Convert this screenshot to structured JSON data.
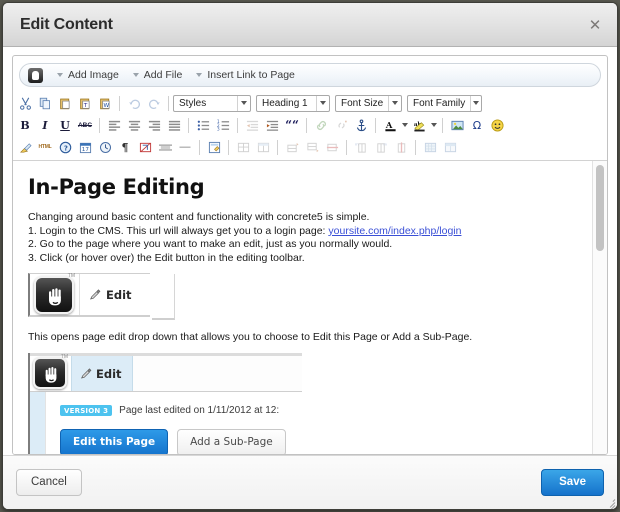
{
  "window": {
    "title": "Edit Content",
    "close_icon": "close-icon"
  },
  "c5bar": {
    "logo_icon": "concrete5-logo-icon",
    "items": [
      {
        "label": "Add Image",
        "icon": "caret-down-icon"
      },
      {
        "label": "Add File",
        "icon": "caret-down-icon"
      },
      {
        "label": "Insert Link to Page",
        "icon": "caret-down-icon"
      }
    ]
  },
  "toolbar": {
    "row1": [
      {
        "name": "cut-icon",
        "glyph": "✂"
      },
      {
        "name": "copy-icon",
        "glyph": ""
      },
      {
        "name": "paste-icon",
        "glyph": ""
      },
      {
        "name": "paste-as-plain-text-icon",
        "glyph": ""
      },
      {
        "name": "paste-from-word-icon",
        "glyph": ""
      },
      {
        "name": "undo-icon",
        "glyph": "↶"
      },
      {
        "name": "redo-icon",
        "glyph": "↷"
      }
    ],
    "selects": [
      {
        "name": "styles-select",
        "value": "Styles"
      },
      {
        "name": "format-select",
        "value": "Heading 1"
      },
      {
        "name": "font-size-select",
        "value": "Font Size"
      },
      {
        "name": "font-family-select",
        "value": "Font Family"
      }
    ],
    "row2": [
      {
        "name": "bold-icon",
        "glyph": "B"
      },
      {
        "name": "italic-icon",
        "glyph": "I"
      },
      {
        "name": "underline-icon",
        "glyph": "U"
      },
      {
        "name": "strikethrough-icon",
        "glyph": "ABC"
      },
      {
        "name": "align-left-icon",
        "glyph": ""
      },
      {
        "name": "align-center-icon",
        "glyph": ""
      },
      {
        "name": "align-right-icon",
        "glyph": ""
      },
      {
        "name": "align-justify-icon",
        "glyph": ""
      },
      {
        "name": "bulleted-list-icon",
        "glyph": ""
      },
      {
        "name": "numbered-list-icon",
        "glyph": ""
      },
      {
        "name": "decrease-indent-icon",
        "glyph": ""
      },
      {
        "name": "increase-indent-icon",
        "glyph": ""
      },
      {
        "name": "blockquote-icon",
        "glyph": "““"
      },
      {
        "name": "link-icon",
        "glyph": ""
      },
      {
        "name": "unlink-icon",
        "glyph": ""
      },
      {
        "name": "anchor-icon",
        "glyph": "⚓"
      },
      {
        "name": "text-color-icon",
        "glyph": "A"
      },
      {
        "name": "text-color-dropdown-icon",
        "glyph": ""
      },
      {
        "name": "background-color-icon",
        "glyph": "ab"
      },
      {
        "name": "background-color-dropdown-icon",
        "glyph": ""
      },
      {
        "name": "image-icon",
        "glyph": ""
      },
      {
        "name": "special-character-icon",
        "glyph": "Ω"
      },
      {
        "name": "smiley-icon",
        "glyph": "☺"
      }
    ],
    "row3": [
      {
        "name": "remove-format-icon",
        "glyph": ""
      },
      {
        "name": "source-html-icon",
        "glyph": "HTML"
      },
      {
        "name": "about-icon",
        "glyph": "?"
      },
      {
        "name": "insert-date-icon",
        "glyph": ""
      },
      {
        "name": "insert-time-icon",
        "glyph": ""
      },
      {
        "name": "show-blocks-icon",
        "glyph": "¶"
      },
      {
        "name": "insert-flash-icon",
        "glyph": ""
      },
      {
        "name": "page-break-icon",
        "glyph": ""
      },
      {
        "name": "horizontal-rule-icon",
        "glyph": "—"
      },
      {
        "name": "templates-icon",
        "glyph": ""
      },
      {
        "name": "insert-table-icon",
        "glyph": ""
      },
      {
        "name": "table-properties-icon",
        "glyph": ""
      },
      {
        "name": "insert-row-before-icon",
        "glyph": ""
      },
      {
        "name": "insert-row-after-icon",
        "glyph": ""
      },
      {
        "name": "delete-row-icon",
        "glyph": ""
      },
      {
        "name": "insert-column-before-icon",
        "glyph": ""
      },
      {
        "name": "insert-column-after-icon",
        "glyph": ""
      },
      {
        "name": "delete-column-icon",
        "glyph": ""
      },
      {
        "name": "merge-cells-icon",
        "glyph": ""
      },
      {
        "name": "split-cell-icon",
        "glyph": ""
      }
    ]
  },
  "document": {
    "heading": "In-Page Editing",
    "intro": "Changing around basic content and functionality with concrete5 is simple.",
    "step1_prefix": "1. Login to the CMS. This url will always get you to a login page: ",
    "step1_link": "yoursite.com/index.php/login",
    "step2": "2. Go to the page where you want to make an edit, just as you normally would.",
    "step3": "3. Click (or hover over) the Edit button in the editing toolbar.",
    "caption": "This opens page edit drop down that allows you to choose to Edit this Page or Add a Sub-Page.",
    "shot_a": {
      "logo_icon": "concrete5-hand-logo-icon",
      "trademark": "TM",
      "pencil_icon": "pencil-icon",
      "edit_label": "Edit"
    },
    "shot_b": {
      "logo_icon": "concrete5-hand-logo-icon",
      "trademark": "TM",
      "pencil_icon": "pencil-icon",
      "edit_label": "Edit",
      "version_badge": "VERSION 3",
      "version_text": "Page last edited on 1/11/2012 at 12:",
      "primary_button": "Edit this Page",
      "secondary_button": "Add a Sub-Page"
    }
  },
  "footer": {
    "cancel_label": "Cancel",
    "save_label": "Save",
    "resize_icon": "resize-grip-icon"
  },
  "colors": {
    "accent": "#1572cb",
    "badge": "#4dc3ef",
    "link": "#3a4fd6",
    "titlebar": "#e3e3e3"
  }
}
